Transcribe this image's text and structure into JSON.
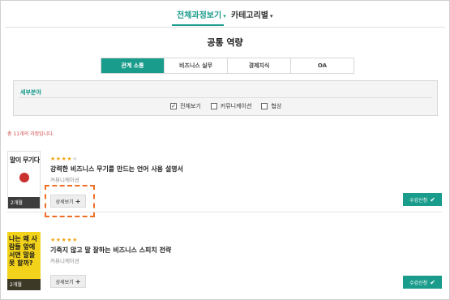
{
  "topnav": {
    "all_label": "전체과정보기",
    "category_label": "카테고리별"
  },
  "section": {
    "title": "공통 역량"
  },
  "category_tabs": [
    {
      "label": "관계 소통",
      "active": true
    },
    {
      "label": "비즈니스 실무",
      "active": false
    },
    {
      "label": "경제지식",
      "active": false
    },
    {
      "label": "OA",
      "active": false
    }
  ],
  "filter": {
    "title": "세부분야",
    "options": [
      {
        "label": "전체보기",
        "checked": true
      },
      {
        "label": "커뮤니케이션",
        "checked": false
      },
      {
        "label": "협상",
        "checked": false
      }
    ]
  },
  "count_text": "총 11개의 과정입니다.",
  "courses": [
    {
      "stars": 4,
      "title": "강력한 비즈니스 무기를 만드는 언어 사용 설명서",
      "category": "커뮤니케이션",
      "thumb_title": "말이 무기다",
      "duration": "2개월",
      "detail_label": "상세보기",
      "apply_label": "수강신청"
    },
    {
      "stars": 5,
      "title": "기죽지 않고 말 잘하는 비즈니스 스피치 전략",
      "category": "커뮤니케이션",
      "thumb_title": "나는 왜 사람들 앞에 서면 말을 못 할까?",
      "duration": "2개월",
      "detail_label": "상세보기",
      "apply_label": "수강신청"
    }
  ],
  "colors": {
    "accent": "#1a9c8c",
    "highlight": "#ef6d24",
    "star": "#f0a81c",
    "count": "#d04848"
  },
  "icons": {
    "caret": "caret-down-icon",
    "plus": "plus-icon",
    "check": "check-icon"
  }
}
